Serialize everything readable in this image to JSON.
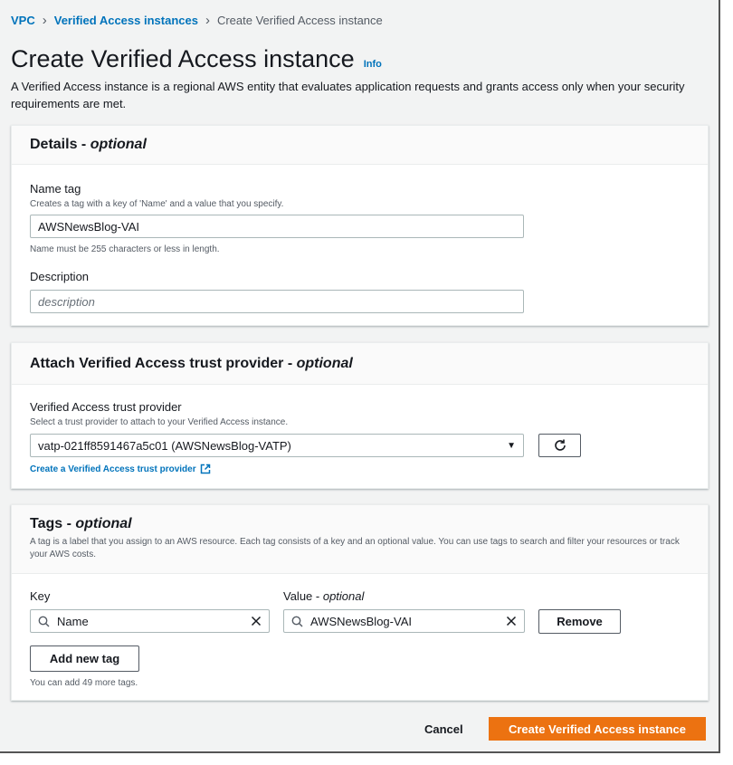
{
  "breadcrumb": {
    "items": [
      "VPC",
      "Verified Access instances"
    ],
    "current": "Create Verified Access instance"
  },
  "page": {
    "title": "Create Verified Access instance",
    "info": "Info",
    "description": "A Verified Access instance is a regional AWS entity that evaluates application requests and grants access only when your security requirements are met."
  },
  "details": {
    "heading": "Details - ",
    "heading_optional": "optional",
    "name_tag_label": "Name tag",
    "name_tag_hint": "Creates a tag with a key of 'Name' and a value that you specify.",
    "name_tag_value": "AWSNewsBlog-VAI",
    "name_tag_constraint": "Name must be 255 characters or less in length.",
    "description_label": "Description",
    "description_placeholder": "description"
  },
  "trust": {
    "heading": "Attach Verified Access trust provider - ",
    "heading_optional": "optional",
    "label": "Verified Access trust provider",
    "hint": "Select a trust provider to attach to your Verified Access instance.",
    "selected": "vatp-021ff8591467a5c01 (AWSNewsBlog-VATP)",
    "create_link": "Create a Verified Access trust provider"
  },
  "tags": {
    "heading": "Tags - ",
    "heading_optional": "optional",
    "description": "A tag is a label that you assign to an AWS resource. Each tag consists of a key and an optional value. You can use tags to search and filter your resources or track your AWS costs.",
    "key_label": "Key",
    "value_label": "Value - ",
    "value_optional": "optional",
    "key_value": "Name",
    "value_value": "AWSNewsBlog-VAI",
    "remove_label": "Remove",
    "add_label": "Add new tag",
    "remaining": "You can add 49 more tags."
  },
  "footer": {
    "cancel": "Cancel",
    "create": "Create Verified Access instance"
  },
  "colors": {
    "link": "#0073bb",
    "primary": "#ec7211",
    "background": "#f2f3f3"
  }
}
